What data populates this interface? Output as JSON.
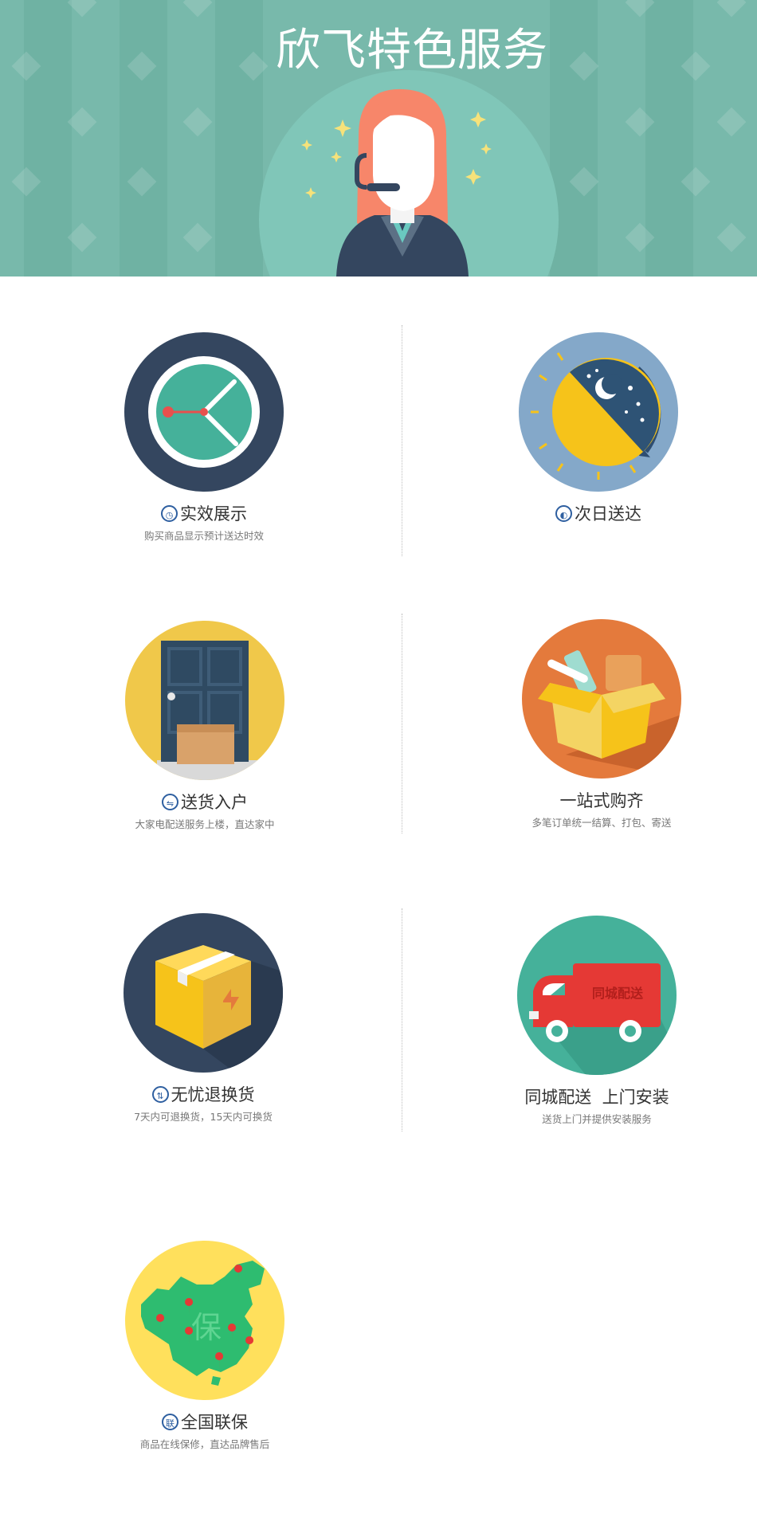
{
  "banner": {
    "title": "欣飞特色服务"
  },
  "services": [
    {
      "title": "实效展示",
      "description": "购买商品显示预计送达时效",
      "badge_icon": "clock-icon"
    },
    {
      "title": "次日送达",
      "description": "",
      "badge_icon": "half-moon-icon"
    },
    {
      "title": "送货入户",
      "description": "大家电配送服务上楼，直达家中",
      "badge_icon": "delivery-icon"
    },
    {
      "title": "一站式购齐",
      "description": "多笔订单统一结算、打包、寄送",
      "badge_icon": ""
    },
    {
      "title": "无忧退换货",
      "description": "7天内可退换货，15天内可换货",
      "badge_icon": "return-icon"
    },
    {
      "title": "同城配送  上门安装",
      "description": "送货上门并提供安装服务",
      "badge_icon": ""
    },
    {
      "title": "全国联保",
      "description": "商品在线保修，直达品牌售后",
      "badge_icon": "lian-icon",
      "badge_text": "联"
    }
  ],
  "illustrations": {
    "truck_label": "同城配送",
    "map_label": "保"
  },
  "colors": {
    "banner_bg": "#78b9ab",
    "badge_blue": "#2e5fa0",
    "navy": "#34465f",
    "teal": "#45b19a",
    "yellow": "#f3c744",
    "orange": "#e47a3c",
    "red": "#e53935"
  }
}
